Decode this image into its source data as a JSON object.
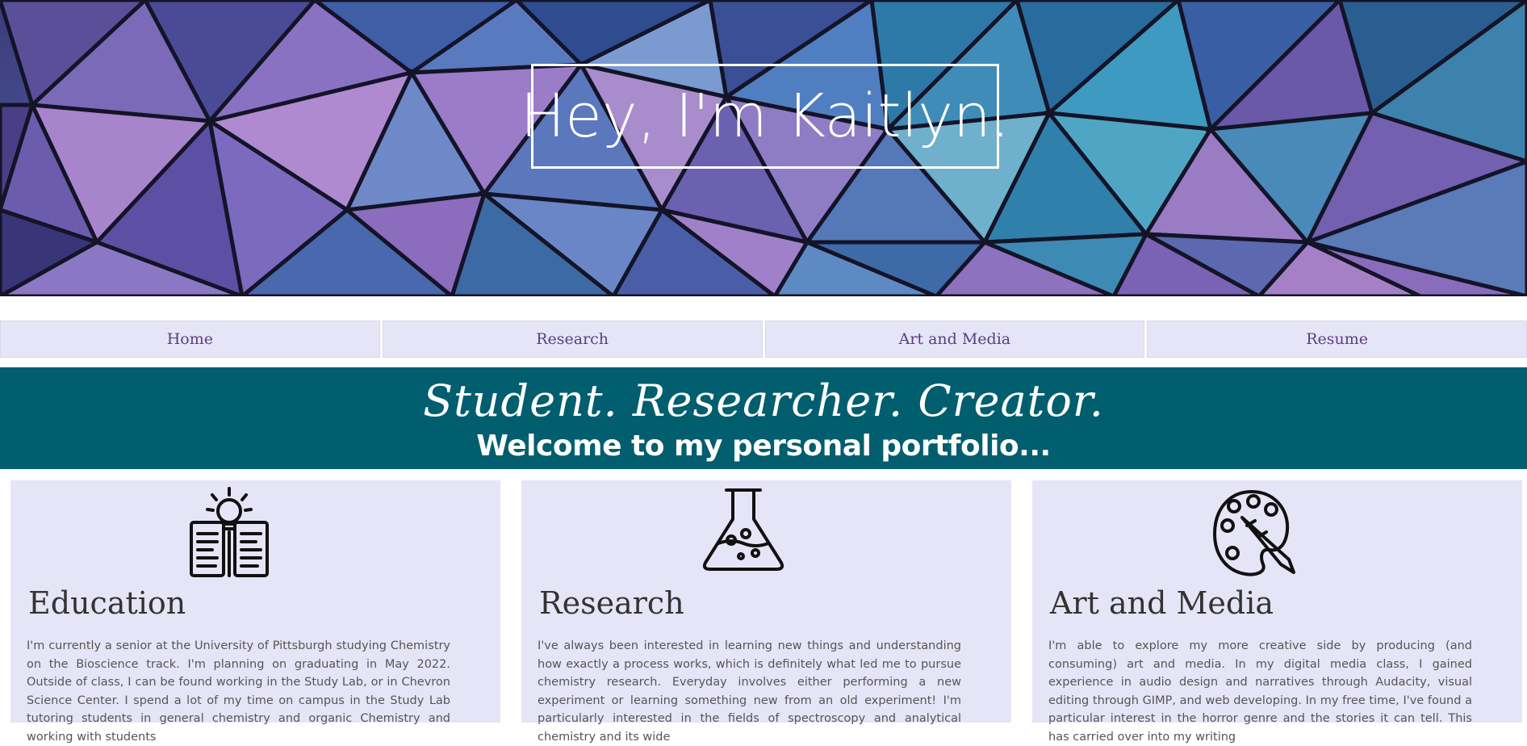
{
  "hero": {
    "title": "Hey, I'm Kaitlyn."
  },
  "nav": {
    "items": [
      {
        "label": "Home"
      },
      {
        "label": "Research"
      },
      {
        "label": "Art and Media"
      },
      {
        "label": "Resume"
      }
    ]
  },
  "banner": {
    "tagline": "Student. Researcher. Creator.",
    "welcome": "Welcome to my personal portfolio..."
  },
  "cards": [
    {
      "icon": "book-lightbulb-icon",
      "heading": "Education",
      "text": "I'm currently a senior at the University of Pittsburgh studying Chemistry on the Bioscience track. I'm planning on graduating in May 2022. Outside of class, I can be found working in the Study Lab, or in Chevron Science Center. I spend a lot of my time on campus in the Study Lab tutoring students in general chemistry and organic Chemistry and working with students"
    },
    {
      "icon": "flask-icon",
      "heading": "Research",
      "text": "I've always been interested in learning new things and understanding how exactly a process works, which is definitely what led me to pursue chemistry research. Everyday involves either performing a new experiment or learning something new from an old experiment! I'm particularly interested in the fields of spectroscopy and analytical chemistry and its wide"
    },
    {
      "icon": "paint-palette-icon",
      "heading": "Art and Media",
      "text": "I'm able to explore my more creative side by producing (and consuming) art and media. In my digital media class, I gained experience in audio design and narratives through Audacity, visual editing through GIMP, and web developing. In my free time, I've found a particular interest in the horror genre and the stories it can tell. This has carried over into my writing"
    }
  ]
}
